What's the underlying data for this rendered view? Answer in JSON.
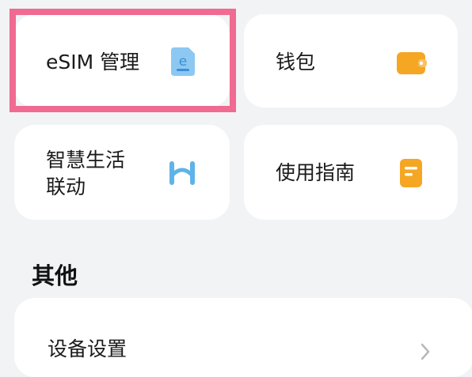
{
  "cards": {
    "esim": {
      "label": "eSIM 管理",
      "icon": "esim-card-icon",
      "color": "#6fb6ee"
    },
    "wallet": {
      "label": "钱包",
      "icon": "wallet-icon",
      "color": "#f5a623"
    },
    "smart_life": {
      "label_line1": "智慧生活",
      "label_line2": "联动",
      "icon": "smart-life-link-icon",
      "color": "#5fb3e8"
    },
    "guide": {
      "label": "使用指南",
      "icon": "guide-doc-icon",
      "color": "#f5a623"
    }
  },
  "section": {
    "title": "其他"
  },
  "settings": {
    "label": "设备设置",
    "icon": "chevron-right-icon"
  },
  "highlight_color": "#f06a92"
}
